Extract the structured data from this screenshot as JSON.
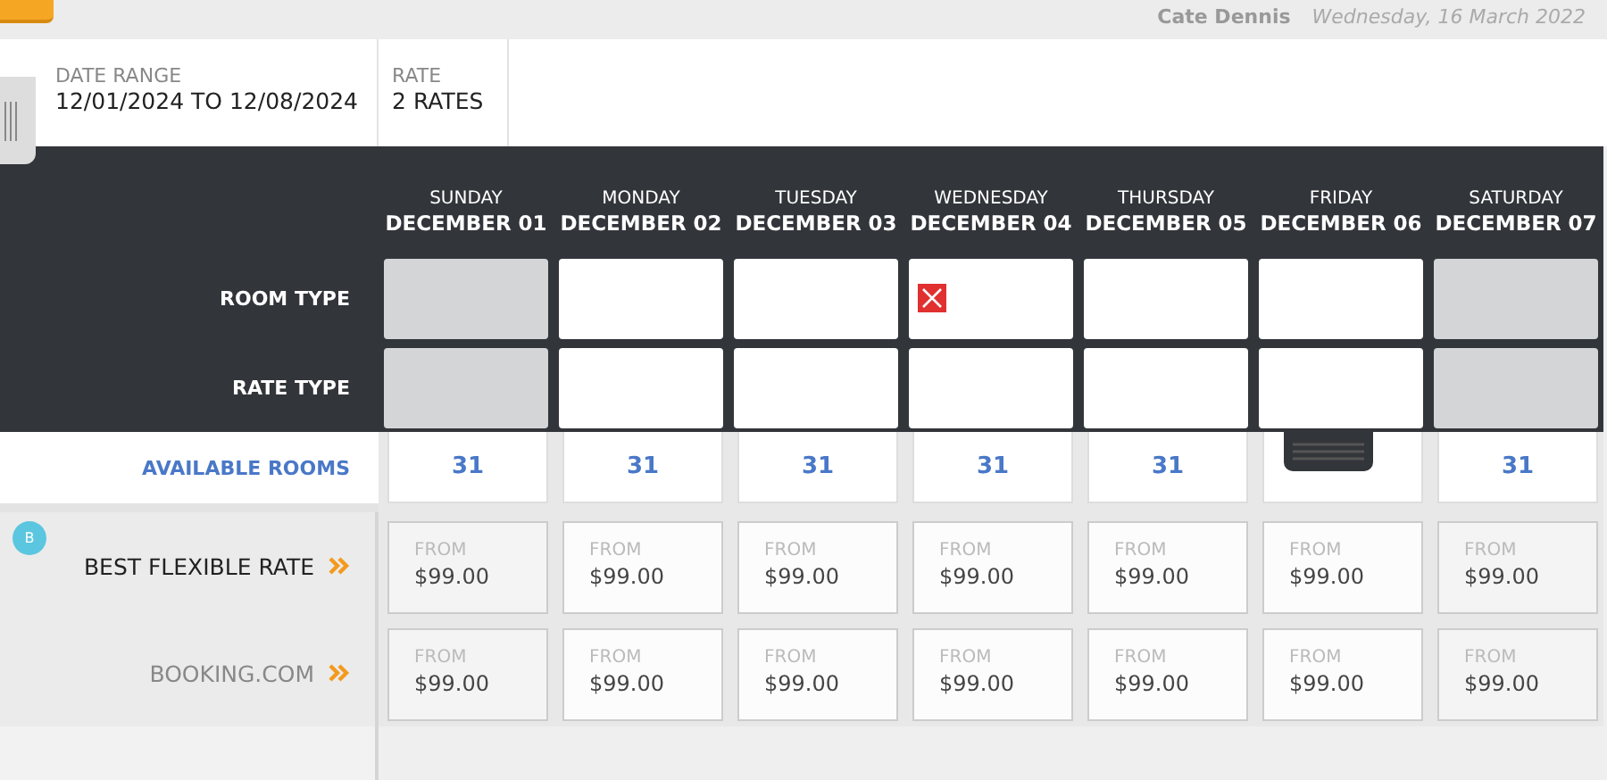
{
  "header": {
    "user": "Cate Dennis",
    "date": "Wednesday, 16 March 2022"
  },
  "filters": [
    {
      "label": "DATE RANGE",
      "value": "12/01/2024 TO 12/08/2024"
    },
    {
      "label": "RATE",
      "value": "2 RATES"
    }
  ],
  "row_labels": {
    "room_type": "ROOM TYPE",
    "rate_type": "RATE TYPE",
    "available": "AVAILABLE ROOMS"
  },
  "days": [
    {
      "weekday": "SUNDAY",
      "date": "DECEMBER 01",
      "closed": true,
      "room_type_stop": false,
      "available": "31"
    },
    {
      "weekday": "MONDAY",
      "date": "DECEMBER 02",
      "closed": false,
      "room_type_stop": false,
      "available": "31"
    },
    {
      "weekday": "TUESDAY",
      "date": "DECEMBER 03",
      "closed": false,
      "room_type_stop": false,
      "available": "31"
    },
    {
      "weekday": "WEDNESDAY",
      "date": "DECEMBER 04",
      "closed": false,
      "room_type_stop": true,
      "available": "31"
    },
    {
      "weekday": "THURSDAY",
      "date": "DECEMBER 05",
      "closed": false,
      "room_type_stop": false,
      "available": "31"
    },
    {
      "weekday": "FRIDAY",
      "date": "DECEMBER 06",
      "closed": false,
      "room_type_stop": false
    },
    {
      "weekday": "SATURDAY",
      "date": "DECEMBER 07",
      "closed": true,
      "room_type_stop": false,
      "available": "31"
    }
  ],
  "rates": [
    {
      "name": "BEST FLEXIBLE RATE",
      "badge": "B",
      "primary": true,
      "cells": [
        {
          "from": "FROM",
          "price": "$99.00"
        },
        {
          "from": "FROM",
          "price": "$99.00"
        },
        {
          "from": "FROM",
          "price": "$99.00"
        },
        {
          "from": "FROM",
          "price": "$99.00"
        },
        {
          "from": "FROM",
          "price": "$99.00"
        },
        {
          "from": "FROM",
          "price": "$99.00"
        },
        {
          "from": "FROM",
          "price": "$99.00"
        }
      ]
    },
    {
      "name": "BOOKING.COM",
      "primary": false,
      "cells": [
        {
          "from": "FROM",
          "price": "$99.00"
        },
        {
          "from": "FROM",
          "price": "$99.00"
        },
        {
          "from": "FROM",
          "price": "$99.00"
        },
        {
          "from": "FROM",
          "price": "$99.00"
        },
        {
          "from": "FROM",
          "price": "$99.00"
        },
        {
          "from": "FROM",
          "price": "$99.00"
        },
        {
          "from": "FROM",
          "price": "$99.00"
        }
      ]
    }
  ]
}
